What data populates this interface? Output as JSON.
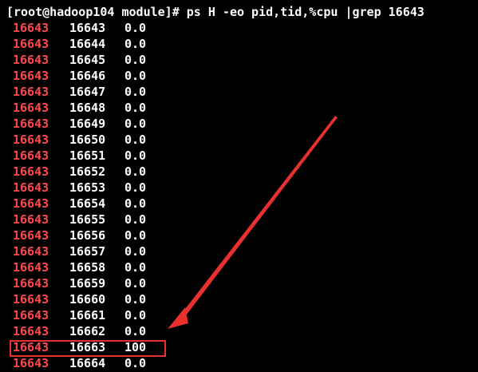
{
  "window": {
    "title": "",
    "background": "#000000"
  },
  "prompt": {
    "text": "[root@hadoop104 module]# ps H -eo pid,tid,%cpu |grep 16643"
  },
  "rows": [
    {
      "pid": "16643",
      "tid": "16643",
      "cpu": "0.0"
    },
    {
      "pid": "16643",
      "tid": "16644",
      "cpu": "0.0"
    },
    {
      "pid": "16643",
      "tid": "16645",
      "cpu": "0.0"
    },
    {
      "pid": "16643",
      "tid": "16646",
      "cpu": "0.0"
    },
    {
      "pid": "16643",
      "tid": "16647",
      "cpu": "0.0"
    },
    {
      "pid": "16643",
      "tid": "16648",
      "cpu": "0.0"
    },
    {
      "pid": "16643",
      "tid": "16649",
      "cpu": "0.0"
    },
    {
      "pid": "16643",
      "tid": "16650",
      "cpu": "0.0"
    },
    {
      "pid": "16643",
      "tid": "16651",
      "cpu": "0.0"
    },
    {
      "pid": "16643",
      "tid": "16652",
      "cpu": "0.0"
    },
    {
      "pid": "16643",
      "tid": "16653",
      "cpu": "0.0"
    },
    {
      "pid": "16643",
      "tid": "16654",
      "cpu": "0.0"
    },
    {
      "pid": "16643",
      "tid": "16655",
      "cpu": "0.0"
    },
    {
      "pid": "16643",
      "tid": "16656",
      "cpu": "0.0"
    },
    {
      "pid": "16643",
      "tid": "16657",
      "cpu": "0.0"
    },
    {
      "pid": "16643",
      "tid": "16658",
      "cpu": "0.0"
    },
    {
      "pid": "16643",
      "tid": "16659",
      "cpu": "0.0"
    },
    {
      "pid": "16643",
      "tid": "16660",
      "cpu": "0.0"
    },
    {
      "pid": "16643",
      "tid": "16661",
      "cpu": "0.0"
    },
    {
      "pid": "16643",
      "tid": "16662",
      "cpu": "0.0"
    },
    {
      "pid": "16643",
      "tid": "16663",
      "cpu": "100"
    },
    {
      "pid": "16643",
      "tid": "16664",
      "cpu": "0.0"
    }
  ],
  "highlight": {
    "row_index": 20,
    "color": "#e8312f"
  },
  "colors": {
    "pid": "#ff4a4a",
    "text": "#ffffff",
    "annotation": "#e8312f"
  }
}
